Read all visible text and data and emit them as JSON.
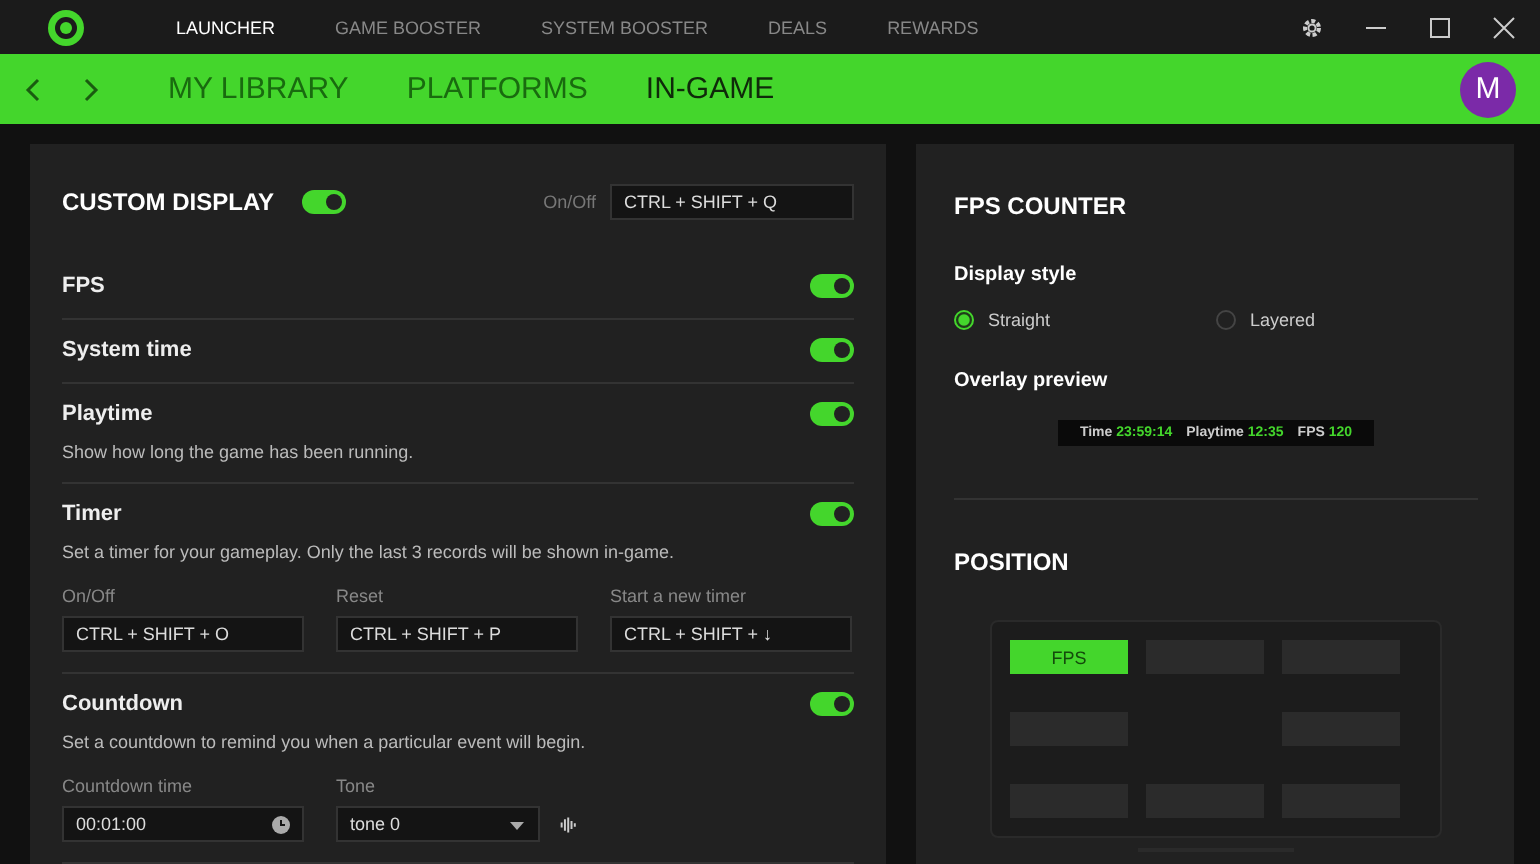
{
  "top_nav": {
    "items": [
      {
        "label": "LAUNCHER",
        "selected": true
      },
      {
        "label": "GAME BOOSTER",
        "selected": false
      },
      {
        "label": "SYSTEM BOOSTER",
        "selected": false
      },
      {
        "label": "DEALS",
        "selected": false
      },
      {
        "label": "REWARDS",
        "selected": false
      }
    ]
  },
  "sub_nav": {
    "tabs": [
      {
        "label": "MY LIBRARY",
        "selected": false
      },
      {
        "label": "PLATFORMS",
        "selected": false
      },
      {
        "label": "IN-GAME",
        "selected": true
      }
    ],
    "avatar": "M"
  },
  "custom_display": {
    "title": "CUSTOM DISPLAY",
    "on": true,
    "hotkey_label": "On/Off",
    "hotkey": "CTRL + SHIFT + Q",
    "rows": [
      {
        "title": "FPS",
        "on": true
      },
      {
        "title": "System time",
        "on": true
      },
      {
        "title": "Playtime",
        "on": true,
        "description": "Show how long the game has been running."
      },
      {
        "title": "Timer",
        "on": true,
        "description": "Set a timer for your gameplay. Only the last 3 records will be shown in-game.",
        "fields": [
          {
            "kind": "hotkey",
            "label": "On/Off",
            "value": "CTRL + SHIFT + O"
          },
          {
            "kind": "hotkey",
            "label": "Reset",
            "value": "CTRL + SHIFT + P"
          },
          {
            "kind": "hotkey",
            "label": "Start a new timer",
            "value": "CTRL + SHIFT + ↓"
          }
        ]
      },
      {
        "title": "Countdown",
        "on": true,
        "description": "Set a countdown to remind you when a particular event will begin.",
        "fields": [
          {
            "kind": "time",
            "label": "Countdown time",
            "value": "00:01:00"
          },
          {
            "kind": "dropdown",
            "label": "Tone",
            "value": "tone 0"
          }
        ]
      }
    ]
  },
  "fps_counter": {
    "title": "FPS COUNTER",
    "display_style_label": "Display style",
    "styles": [
      {
        "label": "Straight",
        "selected": true
      },
      {
        "label": "Layered",
        "selected": false
      }
    ],
    "preview_label": "Overlay preview",
    "preview": [
      {
        "name": "Time",
        "value": "23:59:14"
      },
      {
        "name": "Playtime",
        "value": "12:35"
      },
      {
        "name": "FPS",
        "value": "120"
      }
    ]
  },
  "position": {
    "title": "POSITION",
    "slots": [
      {
        "kind": "slot",
        "label": "FPS",
        "selected": true
      },
      {
        "kind": "slot",
        "selected": false
      },
      {
        "kind": "slot",
        "selected": false
      },
      {
        "kind": "slot",
        "selected": false
      },
      {
        "kind": "empty"
      },
      {
        "kind": "slot",
        "selected": false
      },
      {
        "kind": "slot",
        "selected": false
      },
      {
        "kind": "slot",
        "selected": false
      },
      {
        "kind": "slot",
        "selected": false
      }
    ]
  }
}
